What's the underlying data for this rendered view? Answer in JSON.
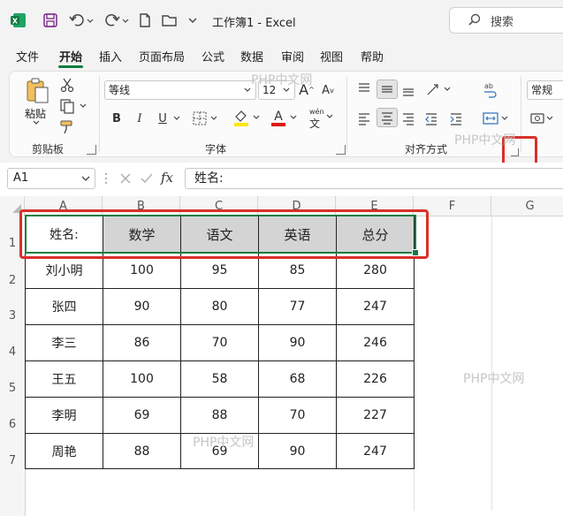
{
  "titlebar": {
    "title": "工作簿1 - Excel",
    "search_placeholder": "搜索"
  },
  "tabs": [
    {
      "label": "文件",
      "active": false
    },
    {
      "label": "开始",
      "active": true
    },
    {
      "label": "插入",
      "active": false
    },
    {
      "label": "页面布局",
      "active": false
    },
    {
      "label": "公式",
      "active": false
    },
    {
      "label": "数据",
      "active": false
    },
    {
      "label": "审阅",
      "active": false
    },
    {
      "label": "视图",
      "active": false
    },
    {
      "label": "帮助",
      "active": false
    }
  ],
  "ribbon": {
    "clipboard": {
      "paste_label": "粘贴",
      "group_label": "剪贴板"
    },
    "font": {
      "font_name": "等线",
      "font_size": "12",
      "group_label": "字体",
      "bold": "B",
      "italic": "I",
      "underline": "U",
      "phonetic": "wén"
    },
    "alignment": {
      "group_label": "对齐方式"
    },
    "number": {
      "format": "常规"
    }
  },
  "formula_bar": {
    "name_box": "A1",
    "fx": "fx",
    "content": "姓名:"
  },
  "sheet": {
    "columns": [
      "A",
      "B",
      "C",
      "D",
      "E",
      "F",
      "G"
    ],
    "rows": [
      "1",
      "2",
      "3",
      "4",
      "5",
      "6",
      "7"
    ],
    "header": [
      "姓名:",
      "数学",
      "语文",
      "英语",
      "总分"
    ],
    "data": [
      [
        "刘小明",
        "100",
        "95",
        "85",
        "280"
      ],
      [
        "张四",
        "90",
        "80",
        "77",
        "247"
      ],
      [
        "李三",
        "86",
        "70",
        "90",
        "246"
      ],
      [
        "王五",
        "100",
        "58",
        "68",
        "226"
      ],
      [
        "李明",
        "69",
        "88",
        "70",
        "227"
      ],
      [
        "周艳",
        "88",
        "69",
        "90",
        "247"
      ]
    ]
  },
  "watermark": "PHP中文网",
  "colors": {
    "accent": "#107c41",
    "highlight_red": "#d9302a",
    "header_fill": "#d4d4d4"
  }
}
